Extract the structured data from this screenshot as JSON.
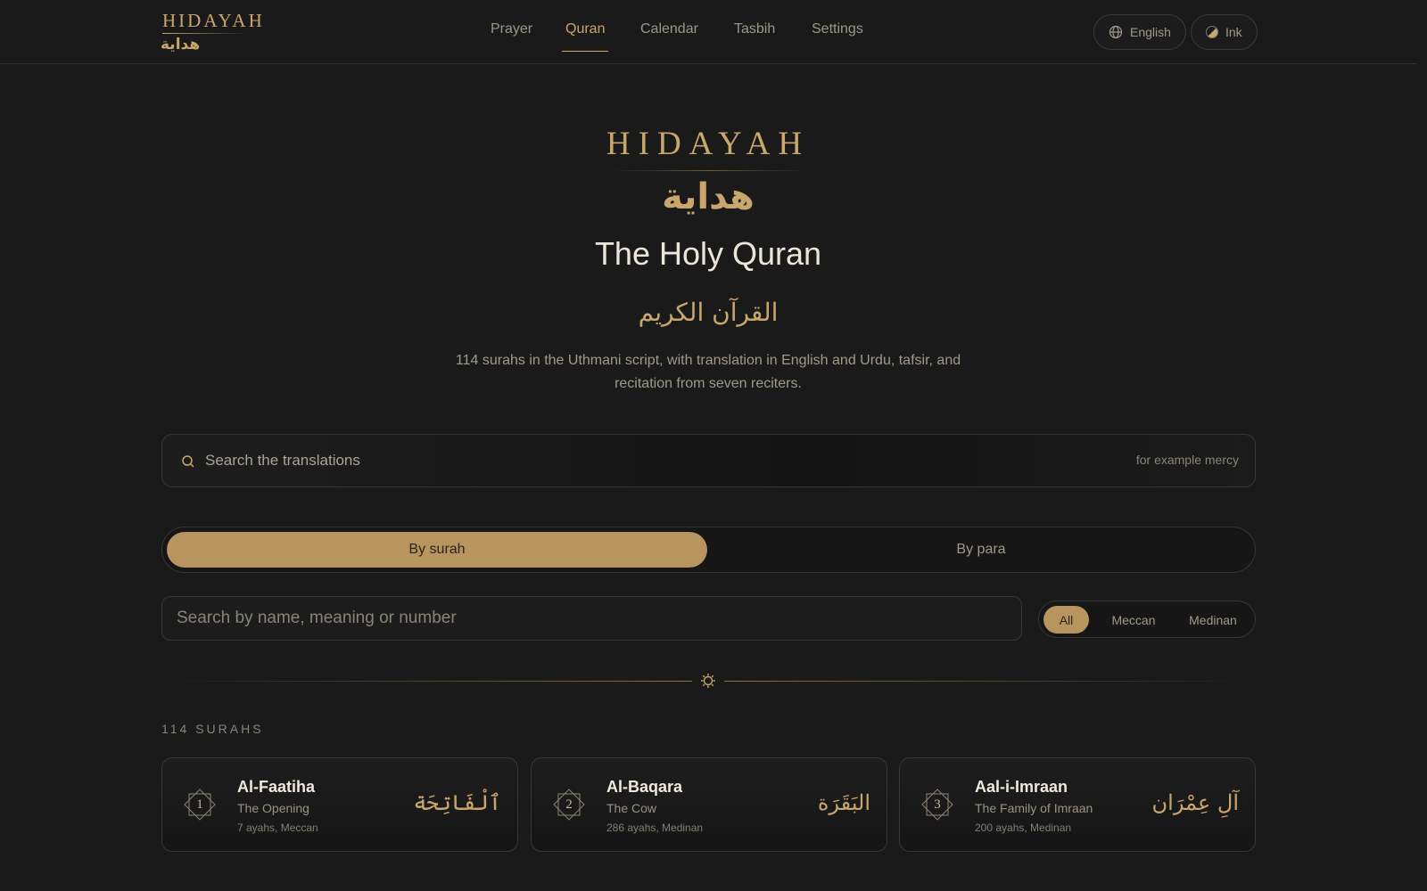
{
  "header": {
    "logo_latin": "HIDAYAH",
    "logo_arabic": "هداية",
    "nav": [
      {
        "label": "Prayer",
        "active": false
      },
      {
        "label": "Quran",
        "active": true
      },
      {
        "label": "Calendar",
        "active": false
      },
      {
        "label": "Tasbih",
        "active": false
      },
      {
        "label": "Settings",
        "active": false
      }
    ],
    "language_label": "English",
    "language_icon": "globe-icon",
    "theme_label": "Ink",
    "theme_icon": "ink-icon"
  },
  "hero": {
    "brand": "HIDAYAH",
    "brand_arabic": "هداية",
    "title": "The Holy Quran",
    "title_arabic": "القرآن الكريم",
    "description": "114 surahs in the Uthmani script, with translation in English and Urdu, tafsir, and recitation from seven reciters."
  },
  "search": {
    "placeholder": "Search the translations",
    "hint": "for example mercy",
    "icon": "search-icon"
  },
  "view_toggle": {
    "options": [
      {
        "label": "By surah",
        "active": true
      },
      {
        "label": "By para",
        "active": false
      }
    ]
  },
  "filter": {
    "placeholder": "Search by name, meaning or number",
    "options": [
      {
        "label": "All",
        "active": true
      },
      {
        "label": "Meccan",
        "active": false
      },
      {
        "label": "Medinan",
        "active": false
      }
    ]
  },
  "list": {
    "count_label": "114 SURAHS",
    "surahs": [
      {
        "number": "1",
        "name": "Al-Faatiha",
        "meaning": "The Opening",
        "meta": "7 ayahs, Meccan",
        "arabic": "ٱلْفَاتِحَة"
      },
      {
        "number": "2",
        "name": "Al-Baqara",
        "meaning": "The Cow",
        "meta": "286 ayahs, Medinan",
        "arabic": "البَقَرَة"
      },
      {
        "number": "3",
        "name": "Aal-i-Imraan",
        "meaning": "The Family of Imraan",
        "meta": "200 ayahs, Medinan",
        "arabic": "آلِ عِمْرَان"
      }
    ]
  },
  "colors": {
    "accent": "#c9a66b",
    "background": "#1a1a1a",
    "active_fill": "#b8955e"
  }
}
